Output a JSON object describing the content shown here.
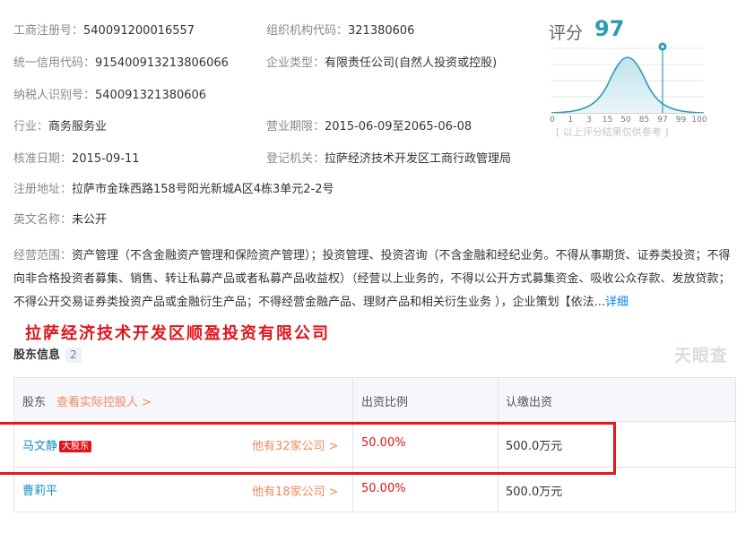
{
  "info": {
    "reg_no": {
      "label": "工商注册号：",
      "value": "540091200016557"
    },
    "org_code": {
      "label": "组织机构代码：",
      "value": "321380606"
    },
    "credit_code": {
      "label": "统一信用代码：",
      "value": "915400913213806066"
    },
    "company_type": {
      "label": "企业类型：",
      "value": "有限责任公司(自然人投资或控股)"
    },
    "taxpayer_id": {
      "label": "纳税人识别号：",
      "value": "540091321380606"
    },
    "industry": {
      "label": "行业：",
      "value": "商务服务业"
    },
    "business_term": {
      "label": "营业期限：",
      "value": "2015-06-09至2065-06-08"
    },
    "approval_date": {
      "label": "核准日期：",
      "value": "2015-09-11"
    },
    "registration_authority": {
      "label": "登记机关：",
      "value": "拉萨经济技术开发区工商行政管理局"
    },
    "address": {
      "label": "注册地址：",
      "value": "拉萨市金珠西路158号阳光新城A区4栋3单元2-2号"
    },
    "english_name": {
      "label": "英文名称：",
      "value": "未公开"
    },
    "scope": {
      "label": "经营范围：",
      "value": "资产管理（不含金融资产管理和保险资产管理）；投资管理、投资咨询（不含金融和经纪业务。不得从事期货、证券类投资；不得向非合格投资者募集、销售、转让私募产品或者私募产品收益权）（经营以上业务的，不得以公开方式募集资金、吸收公众存款、发放贷款；不得公开交易证券类投资产品或金融衍生产品；不得经营金融产品、理财产品和相关衍生业务 ），企业策划【依法...",
      "more": "详细"
    }
  },
  "score": {
    "label": "评分",
    "value": "97",
    "axis_ticks": [
      "0",
      "1",
      "3",
      "15",
      "50",
      "85",
      "97",
      "99",
      "100"
    ],
    "note": "[ 以上评分结果仅供参考 ]",
    "accent_color": "#2a9db4"
  },
  "company_title": "拉萨经济技术开发区顺盈投资有限公司",
  "shareholders": {
    "title": "股东信息",
    "count": "2",
    "brand": "天眼查",
    "columns": {
      "holder": "股东",
      "view_controller": "查看实际控股人 >",
      "ratio": "出资比例",
      "capital": "认缴出资"
    },
    "rows": [
      {
        "name": "马文静",
        "badge": "大股东",
        "others": "他有32家公司 >",
        "ratio": "50.00%",
        "capital": "500.0万元"
      },
      {
        "name": "曹莉平",
        "badge": "",
        "others": "他有18家公司 >",
        "ratio": "50.00%",
        "capital": "500.0万元"
      }
    ]
  }
}
